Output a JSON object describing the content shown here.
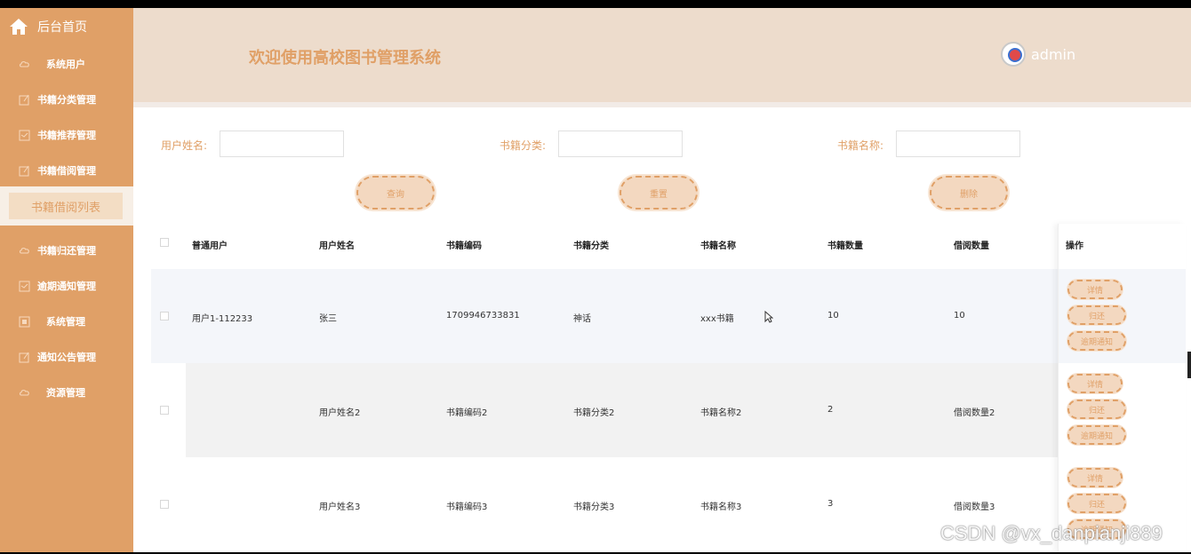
{
  "sidebar": {
    "home": "后台首页",
    "items": [
      {
        "label": "系统用户",
        "icon": "cloud-icon"
      },
      {
        "label": "书籍分类管理",
        "icon": "edit-icon"
      },
      {
        "label": "书籍推荐管理",
        "icon": "message-icon"
      },
      {
        "label": "书籍借阅管理",
        "icon": "edit-icon"
      },
      {
        "label": "书籍归还管理",
        "icon": "cloud-icon"
      },
      {
        "label": "逾期通知管理",
        "icon": "message-icon"
      },
      {
        "label": "系统管理",
        "icon": "square-icon"
      },
      {
        "label": "通知公告管理",
        "icon": "edit-icon"
      },
      {
        "label": "资源管理",
        "icon": "cloud-icon"
      }
    ],
    "active_sub": "书籍借阅列表"
  },
  "header": {
    "title": "欢迎使用高校图书管理系统",
    "username": "admin"
  },
  "search": {
    "user_name_label": "用户姓名:",
    "category_label": "书籍分类:",
    "book_name_label": "书籍名称:",
    "user_name_value": "",
    "category_value": "",
    "book_name_value": "",
    "query_button": "查询",
    "reset_button": "重置",
    "delete_button": "删除"
  },
  "table": {
    "columns": [
      "普通用户",
      "用户姓名",
      "书籍编码",
      "书籍分类",
      "书籍名称",
      "书籍数量",
      "借阅数量",
      "操作"
    ],
    "rows": [
      [
        "用户1-112233",
        "张三",
        "1709946733831",
        "神话",
        "xxx书籍",
        "10",
        "10"
      ],
      [
        "",
        "用户姓名2",
        "书籍编码2",
        "书籍分类2",
        "书籍名称2",
        "2",
        "借阅数量2"
      ],
      [
        "",
        "用户姓名3",
        "书籍编码3",
        "书籍分类3",
        "书籍名称3",
        "3",
        "借阅数量3"
      ]
    ],
    "actions": {
      "detail": "详情",
      "return": "归还",
      "overdue": "逾期通知"
    }
  },
  "watermark": "CSDN @vx_danpianji889",
  "colors": {
    "accent": "#e0a067",
    "header_bg": "#eddccc",
    "active_sub_bg": "#f3ddc4"
  }
}
